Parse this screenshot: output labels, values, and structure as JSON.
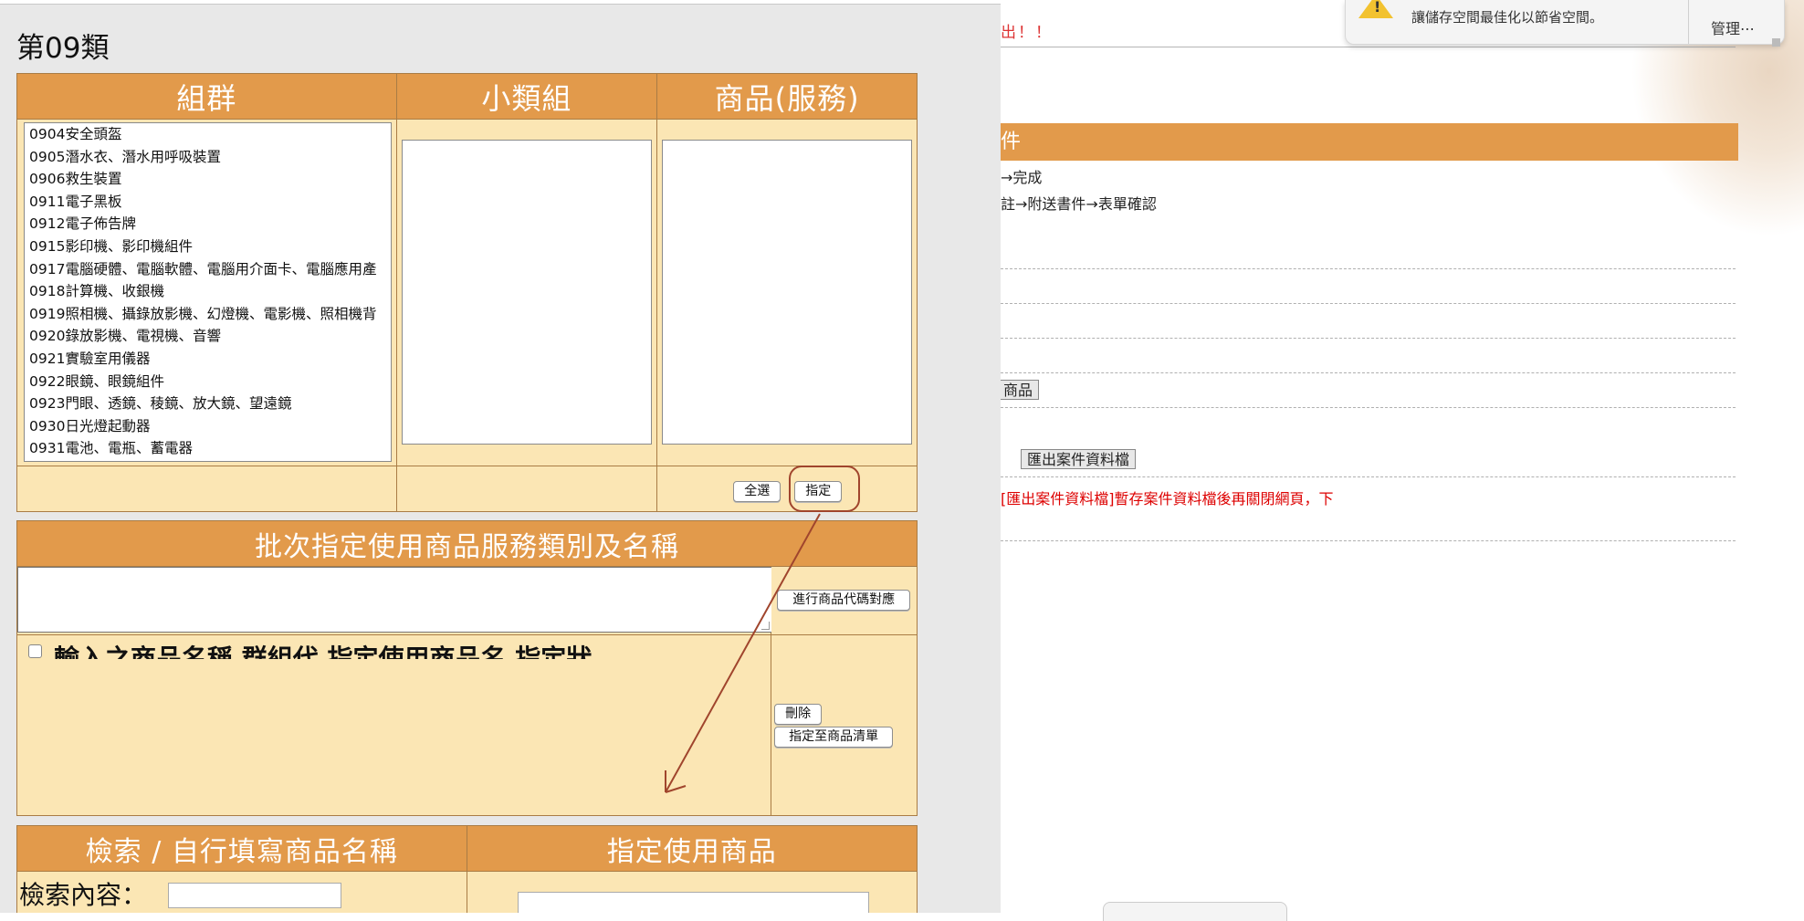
{
  "background_page": {
    "top_red_text": "出！！",
    "section_bar_label": "件",
    "step_line_1": "→完成",
    "step_line_2": "註→附送書件→表單確認",
    "partial_button_label": "商品",
    "export_button_label": "匯出案件資料檔",
    "red_notice": "[匯出案件資料檔]暫存案件資料檔後再關閉網頁，下"
  },
  "notification": {
    "icon": "warning-icon",
    "text": "讓儲存空間最佳化以節省空間。",
    "manage_label": "管理⋯"
  },
  "modal": {
    "title": "第09類",
    "group_table": {
      "headers": [
        "組群",
        "小類組",
        "商品(服務)"
      ],
      "groups": [
        "0904安全頭盔",
        "0905潛水衣、潛水用呼吸裝置",
        "0906救生裝置",
        "0911電子黑板",
        "0912電子佈告牌",
        "0915影印機、影印機組件",
        "0917電腦硬體、電腦軟體、電腦用介面卡、電腦應用產",
        "0918計算機、收銀機",
        "0919照相機、攝錄放影機、幻燈機、電影機、照相機背",
        "0920錄放影機、電視機、音響",
        "0921實驗室用儀器",
        "0922眼鏡、眼鏡組件",
        "0923門眼、透鏡、稜鏡、放大鏡、望遠鏡",
        "0930日光燈起動器",
        "0931電池、電瓶、蓄電器"
      ],
      "select_all_label": "全選",
      "assign_label": "指定"
    },
    "batch_section": {
      "header": "批次指定使用商品服務類別及名稱",
      "textarea_value": "",
      "map_code_button": "進行商品代碼對應",
      "checkbox_label": "輸入之商品名稱 群組代 指定使用商品名 指定狀",
      "delete_button": "刪除",
      "assign_to_list_button": "指定至商品清單"
    },
    "search_section": {
      "header_left": "檢索 / 自行填寫商品名稱",
      "header_right": "指定使用商品",
      "search_label": "檢索內容：",
      "search_value": ""
    }
  },
  "colors": {
    "header_orange": "#e29a4b",
    "cell_cream": "#fbe6b4",
    "annotation_red": "#a0452d"
  }
}
